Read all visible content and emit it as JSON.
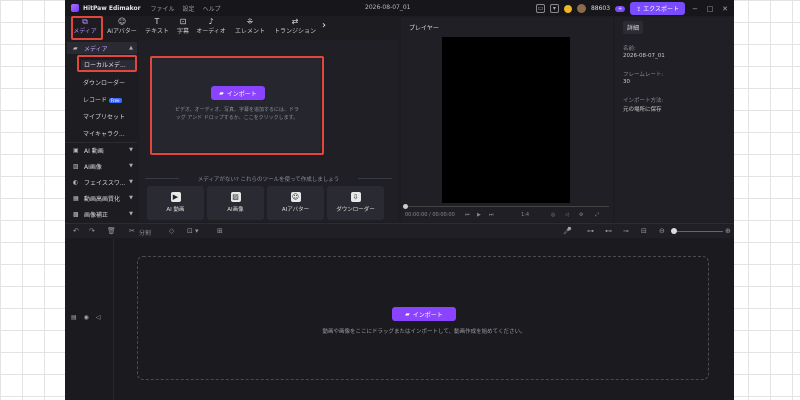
{
  "app": {
    "name": "HitPaw Edimakor",
    "menus": [
      "ファイル",
      "設定",
      "ヘルプ"
    ],
    "document_title": "2026-08-07_01",
    "credits": "88603",
    "export_label": "エクスポート"
  },
  "toolbar": {
    "tools": [
      {
        "label": "メディア",
        "icon": "media-icon"
      },
      {
        "label": "AIアバター",
        "icon": "avatar-icon"
      },
      {
        "label": "テキスト",
        "icon": "text-icon"
      },
      {
        "label": "字幕",
        "icon": "subtitle-icon"
      },
      {
        "label": "オーディオ",
        "icon": "audio-icon"
      },
      {
        "label": "エレメント",
        "icon": "element-icon"
      },
      {
        "label": "トランジション",
        "icon": "transition-icon"
      }
    ]
  },
  "sidebar": {
    "media_label": "メディア",
    "sub_items": [
      "ローカルメデ...",
      "ダウンローダー",
      "レコード",
      "マイプリセット",
      "マイキャラク..."
    ],
    "record_badge": "Free",
    "categories": [
      "AI 動画",
      "AI画像",
      "フェイススワ...",
      "動画高画質化",
      "画像補正"
    ]
  },
  "media_panel": {
    "import_label": "インポート",
    "import_hint": "ビデオ、オーディオ、写真、字幕を追加するには、ドラッグ アンド ドロップするか、ここをクリックします。",
    "no_media_text": "メディアがない? これらのツールを使って作成しましょう",
    "quick_tools": [
      "AI 動画",
      "AI画像",
      "AIアバター",
      "ダウンローダー"
    ]
  },
  "player": {
    "title": "プレイヤー",
    "time": "00:00:00 / 00:00:00",
    "zoom": "1:4"
  },
  "details": {
    "tab": "詳細",
    "name_label": "名前:",
    "name_value": "2026-08-07_01",
    "framerate_label": "フレームレート:",
    "framerate_value": "30",
    "import_method_label": "インポート方法:",
    "import_method_value": "元の場所に保存"
  },
  "timeline": {
    "split_label": "分割",
    "import_label": "インポート",
    "hint": "動画や画像をここにドラッグまたはインポートして、動画作成を始めてください。"
  },
  "colors": {
    "accent": "#8a44ff",
    "highlight": "#e2463c"
  }
}
